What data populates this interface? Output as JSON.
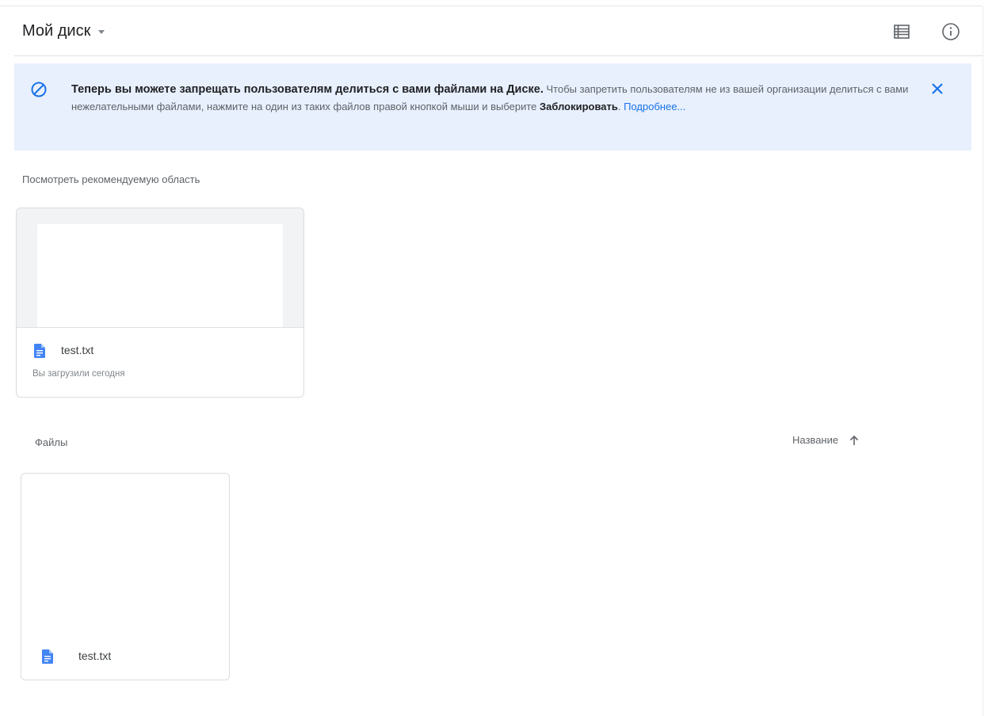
{
  "header": {
    "title": "Мой диск",
    "list_view_icon": "list-view-icon",
    "info_icon": "info-icon"
  },
  "banner": {
    "icon": "block-icon",
    "lead": "Теперь вы можете запрещать пользователям делиться с вами файлами на Диске.",
    "body": " Чтобы запретить пользователям не из вашей организации делиться с вами нежелательными файлами, нажмите на один из таких файлов правой кнопкой мыши и выберите ",
    "bold_action": "Заблокировать",
    "after_bold": ". ",
    "link": "Подробнее...",
    "close_icon": "close-icon",
    "accent_color": "#1a73e8",
    "background_color": "#e8f0fe"
  },
  "suggested": {
    "section_label": "Посмотреть рекомендуемую область",
    "items": [
      {
        "name": "test.txt",
        "subtitle": "Вы загрузили сегодня",
        "icon": "doc-file-icon"
      }
    ]
  },
  "files": {
    "section_label": "Файлы",
    "sort_label": "Название",
    "sort_direction_icon": "arrow-up-icon",
    "items": [
      {
        "name": "test.txt",
        "icon": "doc-file-icon"
      }
    ]
  }
}
